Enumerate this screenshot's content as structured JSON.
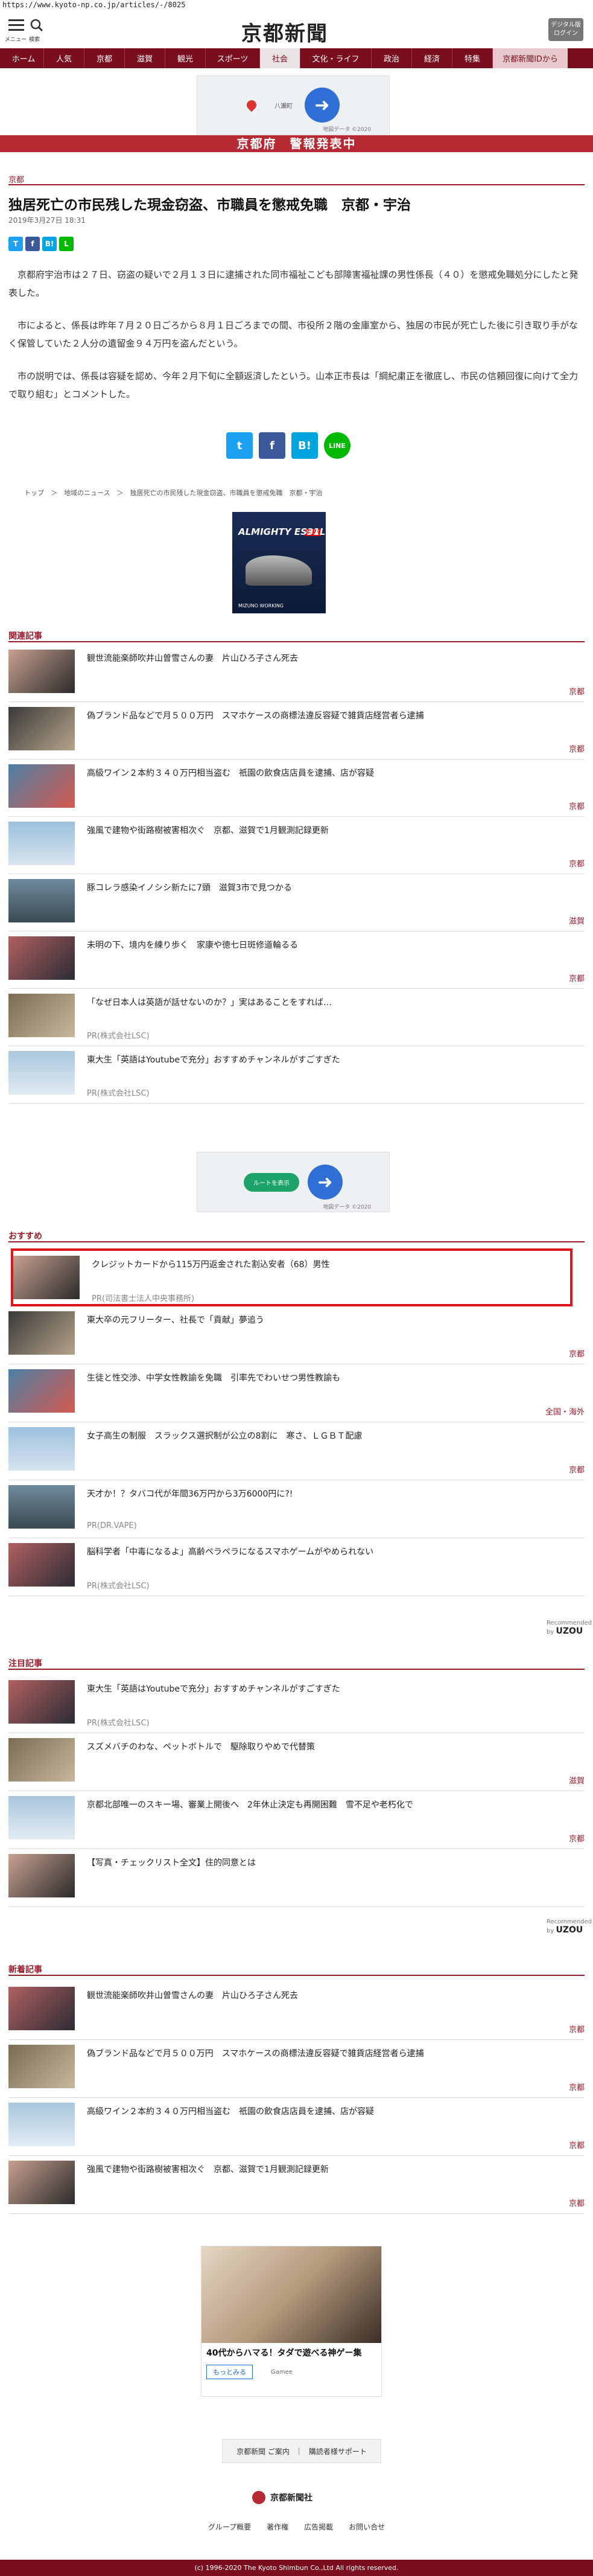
{
  "browser": {
    "url": "https://www.kyoto-np.co.jp/articles/-/8025"
  },
  "header": {
    "menu_label": "メニュー",
    "search_label": "検索",
    "logo": "京都新聞",
    "edition_button": "デジタル版\nログイン"
  },
  "nav": [
    "ホーム",
    "人気",
    "京都",
    "滋賀",
    "観光",
    "スポーツ",
    "社会",
    "文化・ライフ",
    "政治",
    "経済",
    "特集",
    "京都新聞IDから"
  ],
  "nav_active": "社会",
  "ads": {
    "map_caption": "地図データ ©2020",
    "map_label": "八瀬町",
    "route_button": "ルートを表示",
    "shoe_brand": "ALMIGHTY ES31L",
    "shoe_maker": "MIZUNO WORKING",
    "shoe_tag": "NEW",
    "game_ad_title": "40代からハマる！タダで遊べる神ゲー集",
    "game_ad_button": "もっとみる",
    "game_ad_brand": "Gamee"
  },
  "alert": "京都府　警報発表中",
  "article": {
    "category": "京都",
    "title": "独居死亡の市民残した現金窃盗、市職員を懲戒免職　京都・宇治",
    "date": "2019年3月27日 18:31",
    "p1": "京都府宇治市は２７日、窃盗の疑いで２月１３日に逮捕された同市福祉こども部障害福祉課の男性係長（４０）を懲戒免職処分にしたと発表した。",
    "p2": "市によると、係長は昨年７月２０日ごろから８月１日ごろまでの間、市役所２階の金庫室から、独居の市民が死亡した後に引き取り手がなく保管していた２人分の遺留金９４万円を盗んだという。",
    "p3": "市の説明では、係長は容疑を認め、今年２月下旬に全額返済したという。山本正市長は「綱紀粛正を徹底し、市民の信頼回復に向けて全力で取り組む」とコメントした。"
  },
  "share_small": [
    "T",
    "f",
    "B!",
    "L"
  ],
  "share_big": [
    "t",
    "f",
    "B!",
    "LINE"
  ],
  "breadcrumb": "トップ　＞　地域のニュース　＞　独居死亡の市民残した現金窃盗、市職員を懲戒免職　京都・宇治",
  "related": {
    "heading": "関連記事",
    "items": [
      {
        "title": "観世流能楽師吹井山曽雪さんの妻　片山ひろ子さん死去",
        "tag": "京都"
      },
      {
        "title": "偽ブランド品などで月５００万円　スマホケースの商標法違反容疑で雑貨店経営者ら逮捕",
        "tag": "京都"
      },
      {
        "title": "高級ワイン２本約３４０万円相当盗む　祇園の飲食店店員を逮捕、店が容疑",
        "tag": "京都"
      },
      {
        "title": "強風で建物や街路樹被害相次ぐ　京都、滋賀で1月観測記録更新",
        "tag": "京都"
      },
      {
        "title": "豚コレラ感染イノシシ新たに7頭　滋賀3市で見つかる",
        "tag": "滋賀"
      },
      {
        "title": "未明の下、境内を練り歩く　家康や徳七日斑修道輪るる",
        "tag": "京都"
      },
      {
        "title": "「なぜ日本人は英語が話せないのか？」実はあることをすれば…",
        "pr": "PR(株式会社LSC)"
      },
      {
        "title": "東大生「英語はYoutubeで充分」おすすめチャンネルがすごすぎた",
        "pr": "PR(株式会社LSC)"
      }
    ]
  },
  "osusume": {
    "heading": "おすすめ",
    "items": [
      {
        "title": "クレジットカードから115万円返金された割込安者（68）男性",
        "pr": "PR(司法書士法人中央事務所)"
      },
      {
        "title": "東大卒の元フリーター、社長で「貢献」夢追う",
        "tag": "京都"
      },
      {
        "title": "生徒と性交渉、中学女性教諭を免職　引率先でわいせつ男性教諭も",
        "tag": "全国・海外"
      },
      {
        "title": "女子高生の制服　スラックス選択制が公立の8割に　寒さ、ＬＧＢＴ配慮",
        "tag": "京都"
      },
      {
        "title": "天才か！？タバコ代が年間36万円から3万6000円に?!",
        "pr": "PR(DR.VAPE)"
      },
      {
        "title": "脳科学者「中毒になるよ」高齢ペラペラになるスマホゲームがやめられない",
        "pr": "PR(株式会社LSC)"
      }
    ],
    "recommended": "Recommended by",
    "recommended_brand": "UZOU"
  },
  "notice": {
    "heading": "注目記事",
    "items": [
      {
        "title": "東大生「英語はYoutubeで充分」おすすめチャンネルがすごすぎた",
        "pr": "PR(株式会社LSC)"
      },
      {
        "title": "スズメバチのわな、ペットボトルで　駆除取りやめで代替策",
        "tag": "滋賀"
      },
      {
        "title": "京都北部唯一のスキー場、審業上開後へ　2年休止決定も再開困難　雪不足や老朽化で",
        "tag": "京都"
      },
      {
        "title": "【写真・チェックリスト全文】住的同意とは",
        "tag": ""
      }
    ],
    "recommended": "Recommended by",
    "recommended_brand": "UZOU"
  },
  "latest": {
    "heading": "新着記事",
    "items": [
      {
        "title": "観世流能楽師吹井山曽雪さんの妻　片山ひろ子さん死去",
        "tag": "京都"
      },
      {
        "title": "偽ブランド品などで月５００万円　スマホケースの商標法違反容疑で雑貨店経営者ら逮捕",
        "tag": "京都"
      },
      {
        "title": "高級ワイン２本約３４０万円相当盗む　祇園の飲食店店員を逮捕、店が容疑",
        "tag": "京都"
      },
      {
        "title": "強風で建物や街路樹被害相次ぐ　京都、滋賀で1月観測記録更新",
        "tag": "京都"
      }
    ]
  },
  "footer": {
    "links": [
      "京都新聞 ご案内",
      "｜",
      "購読者様サポート"
    ],
    "company": "京都新聞社",
    "nav": [
      "グループ概要",
      "著作権",
      "広告掲載",
      "お問い合せ"
    ],
    "copyright": "(c) 1996-2020 The Kyoto Shimbun Co.,Ltd All rights reserved."
  },
  "colors": {
    "brand": "#7a0e1e",
    "alert": "#b82a33",
    "highlight": "#e0141e"
  }
}
